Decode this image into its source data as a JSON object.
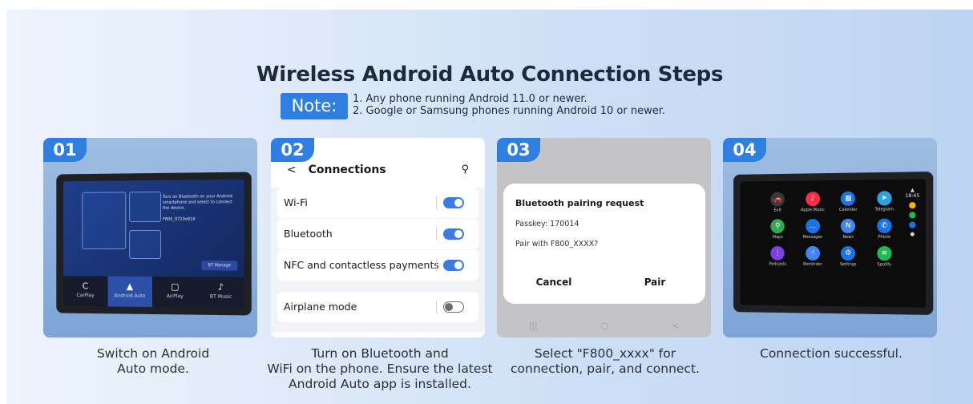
{
  "title": "Wireless Android Auto Connection Steps",
  "note": {
    "label": "Note:",
    "line1": "1. Any phone running Android 11.0 or newer.",
    "line2": "2. Google or Samsung phones running Android 10 or newer."
  },
  "steps": [
    {
      "number": "01",
      "caption_line1": "Switch on Android",
      "caption_line2": "Auto mode.",
      "tabs": [
        {
          "label": "CarPlay",
          "glyph": "C"
        },
        {
          "label": "Android Auto",
          "glyph": "▲"
        },
        {
          "label": "AirPlay",
          "glyph": "▢"
        },
        {
          "label": "BT Music",
          "glyph": "♪"
        }
      ],
      "screen_text": "Turn on Bluetooth on your Android smartphone and select to connect the device.",
      "device_name": "F800_9720e818",
      "bt_manage": "BT Manage"
    },
    {
      "number": "02",
      "caption_line1": "Turn on Bluetooth and",
      "caption_line2": "WiFi on the phone. Ensure the latest",
      "caption_line3": "Android Auto app is installed.",
      "header": "Connections",
      "rows": [
        {
          "label": "Wi-Fi",
          "state": "on"
        },
        {
          "label": "Bluetooth",
          "state": "on"
        },
        {
          "label": "NFC and contactless payments",
          "state": "on"
        },
        {
          "label": "Airplane mode",
          "state": "off"
        }
      ]
    },
    {
      "number": "03",
      "caption_line1": "Select \"F800_xxxx\" for",
      "caption_line2": "connection, pair, and connect.",
      "dialog_title": "Bluetooth pairing request",
      "passkey": "Passkey: 170014",
      "pair_with": "Pair with F800_XXXX?",
      "cancel": "Cancel",
      "pair": "Pair"
    },
    {
      "number": "04",
      "caption_line1": "Connection successful.",
      "apps": [
        {
          "label": "Exit",
          "color": "#3a3a3a",
          "icon": "car-icon",
          "glyph": "🚗"
        },
        {
          "label": "Apple Music",
          "color": "#fa2d48",
          "icon": "music-icon",
          "glyph": "♪"
        },
        {
          "label": "Calendar",
          "color": "#1a73e8",
          "icon": "calendar-icon",
          "glyph": "▦"
        },
        {
          "label": "Telegram",
          "color": "#2aa3e0",
          "icon": "telegram-icon",
          "glyph": "➤"
        },
        {
          "label": "Maps",
          "color": "#34a853",
          "icon": "map-pin-icon",
          "glyph": "⚲"
        },
        {
          "label": "Messages",
          "color": "#1a73e8",
          "icon": "message-icon",
          "glyph": "…"
        },
        {
          "label": "News",
          "color": "#4285f4",
          "icon": "news-icon",
          "glyph": "N"
        },
        {
          "label": "Phone",
          "color": "#1a73e8",
          "icon": "phone-icon",
          "glyph": "✆"
        },
        {
          "label": "Podcasts",
          "color": "#7b3fe4",
          "icon": "podcast-icon",
          "glyph": "⋮"
        },
        {
          "label": "Reminder",
          "color": "#4285f4",
          "icon": "reminder-icon",
          "glyph": "☝"
        },
        {
          "label": "Settings",
          "color": "#1a73e8",
          "icon": "settings-icon",
          "glyph": "⚙"
        },
        {
          "label": "Spotify",
          "color": "#1db954",
          "icon": "spotify-icon",
          "glyph": "≋"
        }
      ],
      "time": "18:45"
    }
  ]
}
